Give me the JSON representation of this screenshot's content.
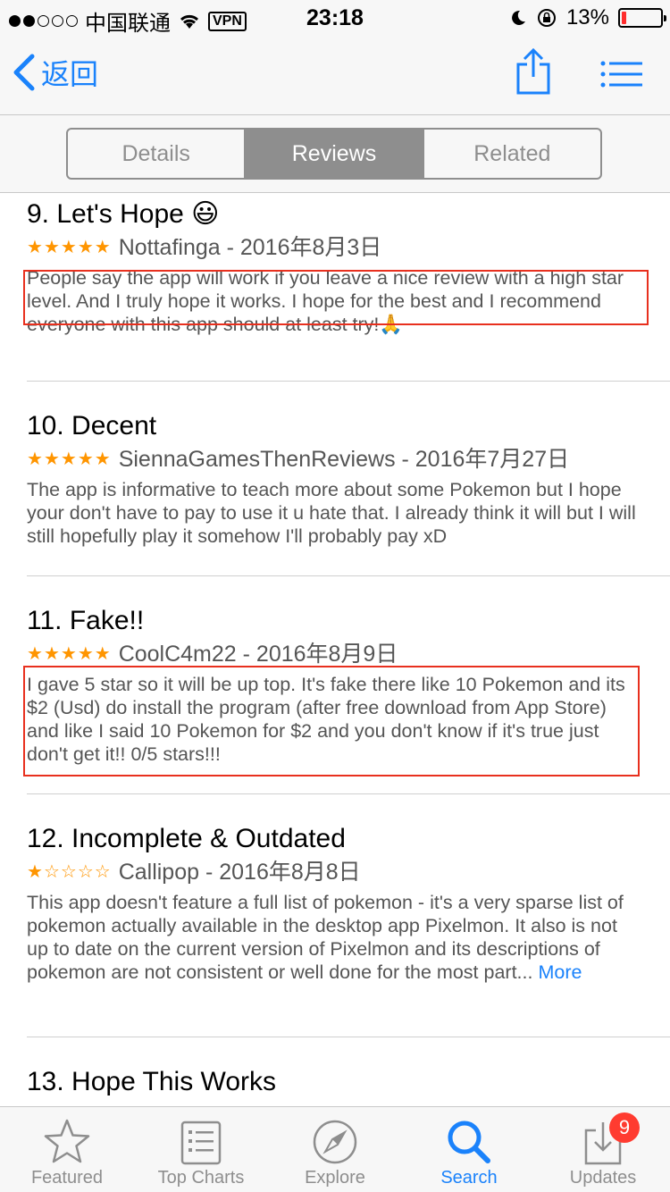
{
  "status_bar": {
    "carrier": "中国联通",
    "vpn": "VPN",
    "time": "23:18",
    "battery": "13%",
    "battery_level": 0.13
  },
  "nav": {
    "back_label": "返回"
  },
  "segments": [
    {
      "label": "Details",
      "active": false
    },
    {
      "label": "Reviews",
      "active": true
    },
    {
      "label": "Related",
      "active": false
    }
  ],
  "reviews": [
    {
      "title": "9. Let's Hope 😃",
      "rating": 5,
      "author_date": "Nottafinga - 2016年8月3日",
      "body": "People say the app will work if you leave a nice review with a high star level. And I truly hope it works. I hope for the best and I recommend everyone with this app should at least try!🙏"
    },
    {
      "title": "10. Decent",
      "rating": 5,
      "author_date": "SiennaGamesThenReviews - 2016年7月27日",
      "body": "The app is informative to teach more about some Pokemon but I hope your don't have to pay to use it u hate that. I already think it will but I will still hopefully play it somehow I'll probably pay xD"
    },
    {
      "title": "11. Fake!!",
      "rating": 5,
      "author_date": "CoolC4m22 - 2016年8月9日",
      "body": "I gave 5 star so it will be up top. It's fake there like 10 Pokemon and its $2 (Usd) do install the program (after free download from App Store) and like I said 10 Pokemon for $2 and you don't know if it's true just don't get it!! 0/5 stars!!!"
    },
    {
      "title": "12. Incomplete & Outdated",
      "rating": 1,
      "author_date": "Callipop - 2016年8月8日",
      "body": "This app doesn't feature a full list of pokemon - it's a very sparse list of pokemon actually available in the desktop app Pixelmon. It also is not up to date on the current version of Pixelmon and its descriptions of pokemon are not consistent or well done for the most part...",
      "more": "More"
    },
    {
      "title": "13. Hope This Works"
    }
  ],
  "tabs": [
    {
      "label": "Featured",
      "icon": "star-icon"
    },
    {
      "label": "Top Charts",
      "icon": "list-icon"
    },
    {
      "label": "Explore",
      "icon": "compass-icon"
    },
    {
      "label": "Search",
      "icon": "search-icon",
      "active": true
    },
    {
      "label": "Updates",
      "icon": "download-icon",
      "badge": "9"
    }
  ],
  "colors": {
    "accent": "#1a82fb",
    "star": "#ff9500",
    "highlight": "#e8301e",
    "badge": "#ff3b30"
  }
}
